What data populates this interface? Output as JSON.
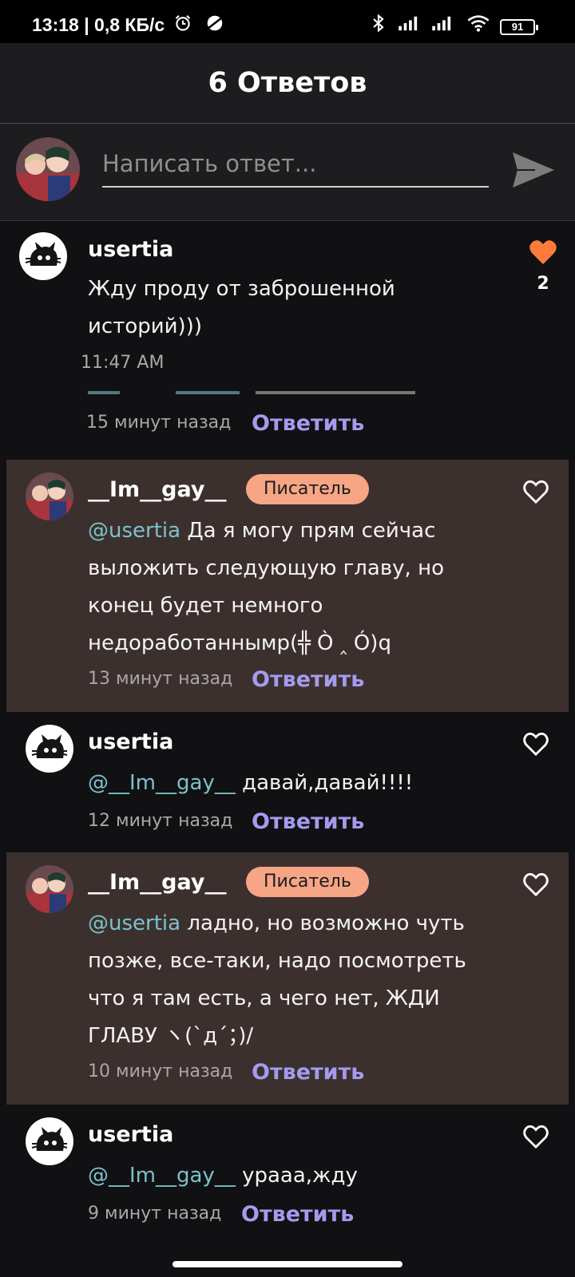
{
  "status_bar": {
    "time": "13:18 | 0,8 КБ/с",
    "battery": "91"
  },
  "header": {
    "title": "6 Ответов"
  },
  "composer": {
    "placeholder": "Написать ответ..."
  },
  "main_comment": {
    "author": "usertia",
    "text": "Жду проду от заброшенной историй)))",
    "time": "11:47 AM",
    "likes": "2"
  },
  "replies": [
    {
      "author": "",
      "mention": "",
      "text": "",
      "time": "15 минут назад",
      "reply_label": "Ответить"
    },
    {
      "author": "__Im__gay__",
      "badge": "Писатель",
      "mention": "@usertia",
      "text": " Да я могу прям сейчас выложить следующую главу, но конец будет немного недоработаннымр(╬ Ò ‸ Ó)q",
      "time": "13 минут назад",
      "reply_label": "Ответить"
    },
    {
      "author": "usertia",
      "mention": "@__Im__gay__",
      "text": " давай,давай!!!!",
      "time": "12 минут назад",
      "reply_label": "Ответить"
    },
    {
      "author": "__Im__gay__",
      "badge": "Писатель",
      "mention": "@usertia",
      "text": " ладно, но возможно чуть позже, все-таки, надо посмотреть что я там есть, а чего нет, ЖДИ ГЛАВУ ヽ(`д´；)/",
      "time": "10 минут назад",
      "reply_label": "Ответить"
    },
    {
      "author": "usertia",
      "mention": "@__Im__gay__",
      "text": " урааа,жду",
      "time": "9 минут назад",
      "reply_label": "Ответить"
    }
  ],
  "colors": {
    "accent_heart": "#ff7b3a",
    "badge": "#f6a585",
    "mention": "#79c3cb",
    "reply": "#a49bee",
    "highlight_bg": "#3c302e"
  },
  "icons": {
    "send": "send-icon",
    "heart_filled": "heart-filled-icon",
    "heart_outline": "heart-outline-icon"
  }
}
